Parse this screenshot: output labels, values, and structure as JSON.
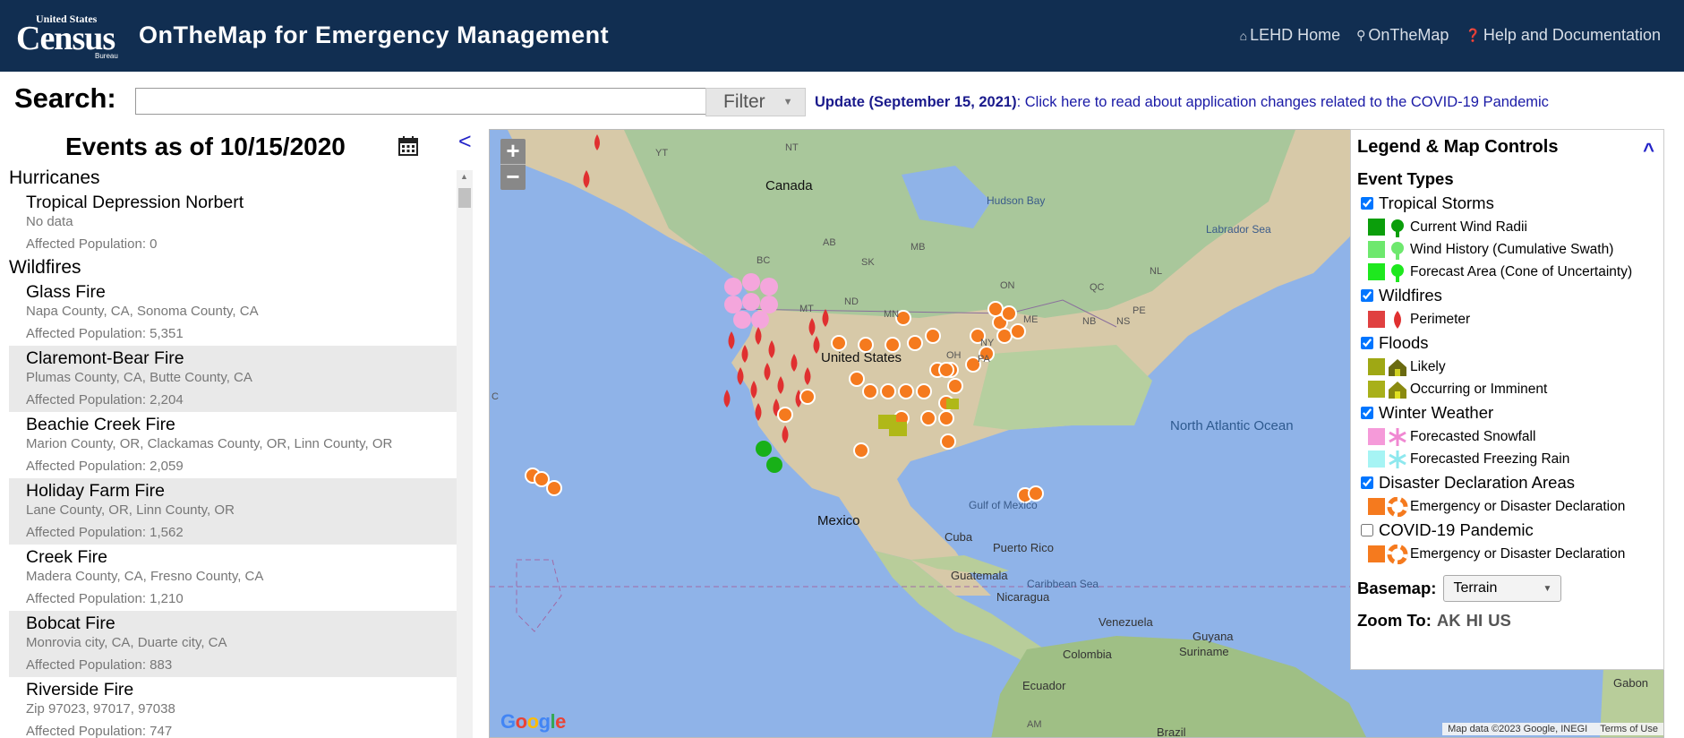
{
  "header": {
    "logo": {
      "line1": "United States",
      "line2": "Census",
      "line3": "Bureau"
    },
    "title": "OnTheMap for Emergency Management",
    "nav": [
      {
        "icon": "home-icon",
        "label": "LEHD Home"
      },
      {
        "icon": "map-pin-icon",
        "label": "OnTheMap"
      },
      {
        "icon": "question-circle-icon",
        "label": "Help and Documentation"
      }
    ]
  },
  "search": {
    "label": "Search:",
    "value": "",
    "filter_label": "Filter"
  },
  "update": {
    "bold": "Update (September 15, 2021)",
    "text": ": Click here to read about application changes related to the COVID-19 Pandemic"
  },
  "events": {
    "title": "Events as of 10/15/2020",
    "collapse_label": "<",
    "categories": [
      {
        "name": "Hurricanes",
        "items": [
          {
            "name": "Tropical Depression Norbert",
            "location": "No data",
            "population": "Affected Population: 0"
          }
        ]
      },
      {
        "name": "Wildfires",
        "items": [
          {
            "name": "Glass Fire",
            "location": "Napa County, CA, Sonoma County, CA",
            "population": "Affected Population: 5,351"
          },
          {
            "name": "Claremont-Bear Fire",
            "location": "Plumas County, CA, Butte County, CA",
            "population": "Affected Population: 2,204"
          },
          {
            "name": "Beachie Creek Fire",
            "location": "Marion County, OR, Clackamas County, OR, Linn County, OR",
            "population": "Affected Population: 2,059"
          },
          {
            "name": "Holiday Farm Fire",
            "location": "Lane County, OR, Linn County, OR",
            "population": "Affected Population: 1,562"
          },
          {
            "name": "Creek Fire",
            "location": "Madera County, CA, Fresno County, CA",
            "population": "Affected Population: 1,210"
          },
          {
            "name": "Bobcat Fire",
            "location": "Monrovia city, CA, Duarte city, CA",
            "population": "Affected Population: 883"
          },
          {
            "name": "Riverside Fire",
            "location": "Zip 97023, 97017, 97038",
            "population": "Affected Population: 747"
          }
        ]
      }
    ]
  },
  "map": {
    "zoom_in": "+",
    "zoom_out": "−",
    "labels": {
      "canada": "Canada",
      "united_states": "United States",
      "mexico": "Mexico",
      "cuba": "Cuba",
      "puerto_rico": "Puerto Rico",
      "guatemala": "Guatemala",
      "nicaragua": "Nicaragua",
      "venezuela": "Venezuela",
      "guyana": "Guyana",
      "suriname": "Suriname",
      "colombia": "Colombia",
      "ecuador": "Ecuador",
      "brazil": "Brazil",
      "gabon": "Gabon",
      "hudson_bay": "Hudson Bay",
      "labrador_sea": "Labrador Sea",
      "gulf_of_mexico": "Gulf of Mexico",
      "caribbean_sea": "Caribbean Sea",
      "north_atlantic": "North Atlantic Ocean",
      "nt": "NT",
      "yt": "YT",
      "bc": "BC",
      "ab": "AB",
      "sk": "SK",
      "mb": "MB",
      "on": "ON",
      "qc": "QC",
      "nl": "NL",
      "nb": "NB",
      "ns": "NS",
      "pe": "PE",
      "mt": "MT",
      "nd": "ND",
      "mn": "MN",
      "ny": "NY",
      "me": "ME",
      "oh": "OH",
      "am": "AM",
      "pa": "PA",
      "c": "C"
    },
    "google_logo": "Google",
    "attribution": "Map data ©2023 Google, INEGI",
    "terms": "Terms of Use"
  },
  "legend": {
    "title": "Legend & Map Controls",
    "collapse_label": "^",
    "subtitle": "Event Types",
    "groups": [
      {
        "label": "Tropical Storms",
        "checked": true,
        "items": [
          {
            "label": "Current Wind Radii",
            "color": "#0b9e0b"
          },
          {
            "label": "Wind History (Cumulative Swath)",
            "color": "#6ee86e"
          },
          {
            "label": "Forecast Area (Cone of Uncertainty)",
            "color": "#1ee81e"
          }
        ]
      },
      {
        "label": "Wildfires",
        "checked": true,
        "items": [
          {
            "label": "Perimeter",
            "color": "#e04040"
          }
        ]
      },
      {
        "label": "Floods",
        "checked": true,
        "items": [
          {
            "label": "Likely",
            "color": "#9fa814"
          },
          {
            "label": "Occurring or Imminent",
            "color": "#a8b01a"
          }
        ]
      },
      {
        "label": "Winter Weather",
        "checked": true,
        "items": [
          {
            "label": "Forecasted Snowfall",
            "color": "#f59ad9"
          },
          {
            "label": "Forecasted Freezing Rain",
            "color": "#a6f4f4"
          }
        ]
      },
      {
        "label": "Disaster Declaration Areas",
        "checked": true,
        "items": [
          {
            "label": "Emergency or Disaster Declaration",
            "color": "#f57a1e"
          }
        ]
      },
      {
        "label": "COVID-19 Pandemic",
        "checked": false,
        "items": [
          {
            "label": "Emergency or Disaster Declaration",
            "color": "#f57a1e"
          }
        ]
      }
    ],
    "basemap_label": "Basemap:",
    "basemap_value": "Terrain",
    "zoom_to_label": "Zoom To:",
    "zoom_to_links": [
      "AK",
      "HI",
      "US"
    ]
  }
}
